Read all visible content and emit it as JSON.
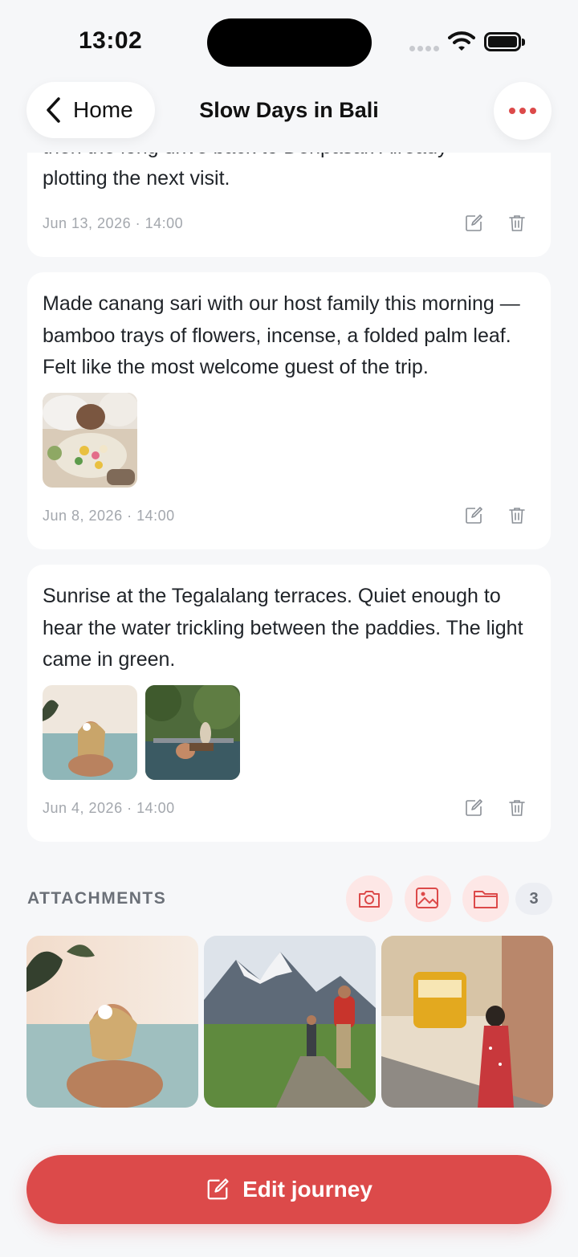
{
  "status_bar": {
    "time": "13:02"
  },
  "header": {
    "back_label": "Home",
    "title": "Slow Days in Bali"
  },
  "entries": [
    {
      "text_clipped": "then the long drive back to Denpasar. Already",
      "text": "plotting the next visit.",
      "date": "Jun 13, 2026 · 14:00"
    },
    {
      "text": "Made canang sari with our host family this morning — bamboo trays of flowers, incense, a folded palm leaf. Felt like the most welcome guest of the trip.",
      "date": "Jun 8, 2026 · 14:00"
    },
    {
      "text": "Sunrise at the Tegalalang terraces. Quiet enough to hear the water trickling between the paddies. The light came in green.",
      "date": "Jun 4, 2026 · 14:00"
    }
  ],
  "attachments": {
    "title": "ATTACHMENTS",
    "count": "3"
  },
  "footer": {
    "edit_label": "Edit journey"
  },
  "colors": {
    "accent": "#dc4a4a",
    "accent_soft": "#fde7e6",
    "background": "#f6f7f9"
  }
}
